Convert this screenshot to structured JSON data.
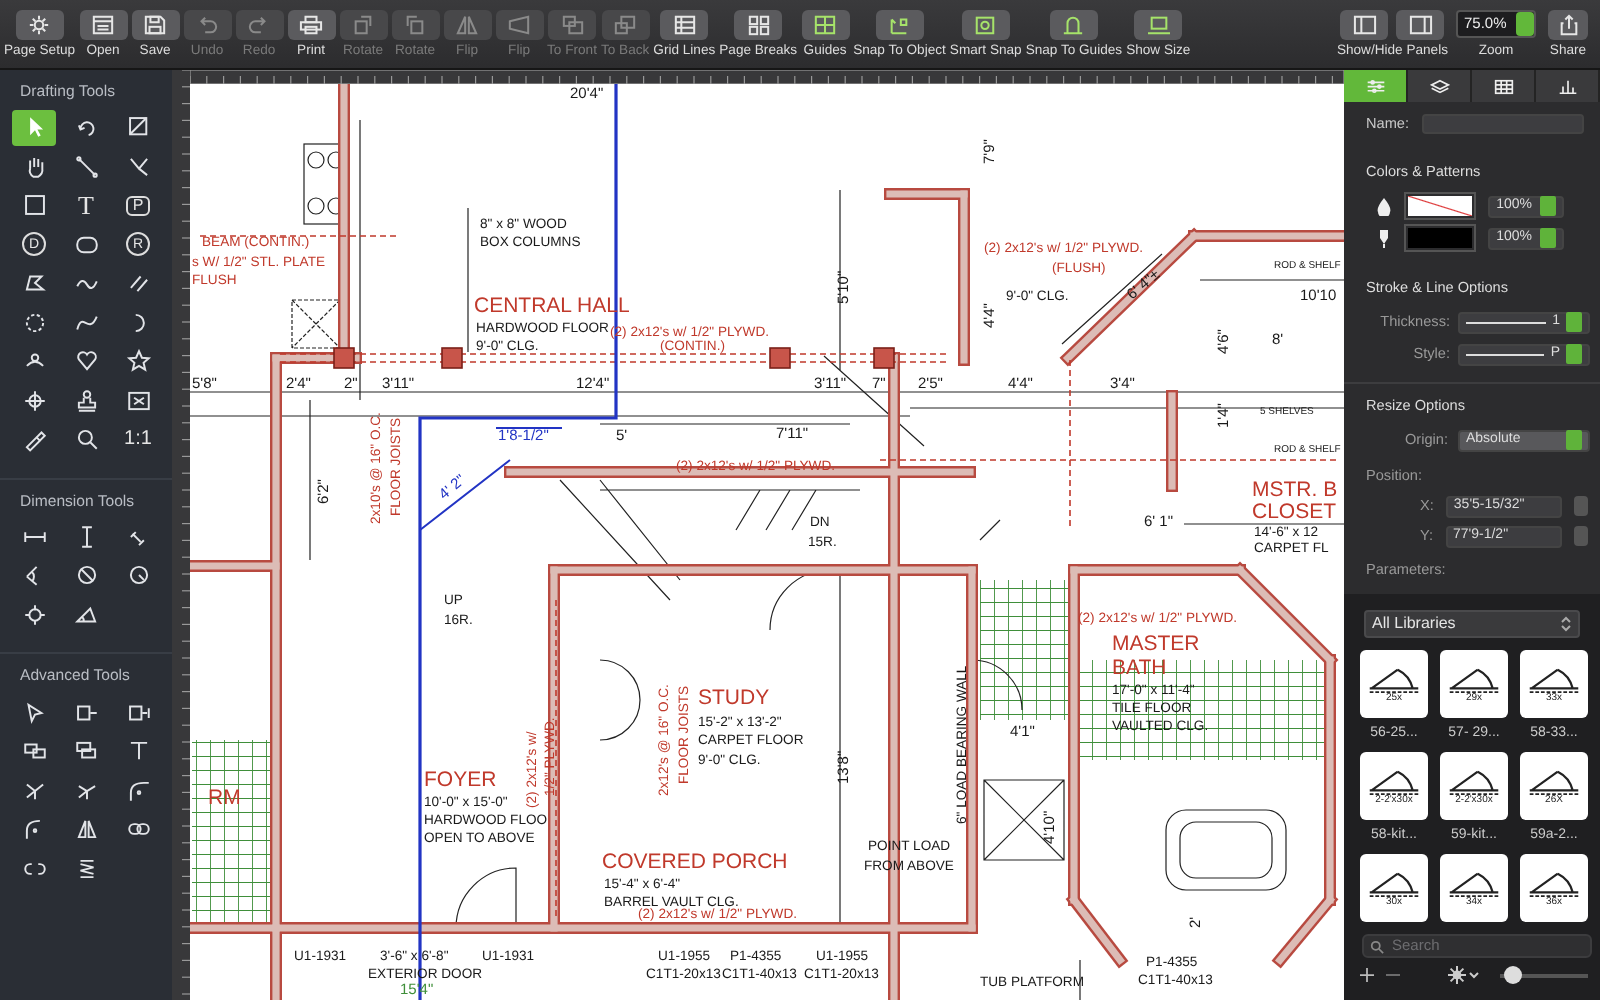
{
  "toolbar": {
    "buttons": [
      {
        "label": "Page Setup",
        "disabled": false,
        "on": false
      },
      {
        "label": "Open",
        "disabled": false,
        "on": false
      },
      {
        "label": "Save",
        "disabled": false,
        "on": false
      },
      {
        "label": "Undo",
        "disabled": true,
        "on": false
      },
      {
        "label": "Redo",
        "disabled": true,
        "on": false
      },
      {
        "label": "Print",
        "disabled": false,
        "on": false
      },
      {
        "label": "Rotate",
        "disabled": true,
        "on": false
      },
      {
        "label": "Rotate",
        "disabled": true,
        "on": false
      },
      {
        "label": "Flip",
        "disabled": true,
        "on": false
      },
      {
        "label": "Flip",
        "disabled": true,
        "on": false
      },
      {
        "label": "To Front",
        "disabled": true,
        "on": false
      },
      {
        "label": "To Back",
        "disabled": true,
        "on": false
      },
      {
        "label": "Grid Lines",
        "disabled": false,
        "on": false
      },
      {
        "label": "Page Breaks",
        "disabled": false,
        "on": false
      },
      {
        "label": "Guides",
        "disabled": false,
        "on": true
      },
      {
        "label": "Snap To Object",
        "disabled": false,
        "on": true
      },
      {
        "label": "Smart Snap",
        "disabled": false,
        "on": true
      },
      {
        "label": "Snap To Guides",
        "disabled": false,
        "on": true
      },
      {
        "label": "Show Size",
        "disabled": false,
        "on": true
      }
    ],
    "panels": {
      "label": "Show/Hide Panels"
    },
    "zoom": {
      "value": "75.0%",
      "label": "Zoom"
    },
    "share": {
      "label": "Share"
    }
  },
  "tool_sections": [
    {
      "title": "Drafting Tools",
      "tools": [
        {
          "selected": true
        },
        {
          "selected": false
        },
        {
          "selected": false
        },
        {
          "selected": false
        },
        {
          "selected": false
        },
        {
          "selected": false
        },
        {
          "selected": false
        },
        {
          "selected": false,
          "glyph": "T"
        },
        {
          "selected": false,
          "glyph": "P"
        },
        {
          "selected": false,
          "glyph": "D"
        },
        {
          "selected": false
        },
        {
          "selected": false,
          "glyph": "R"
        },
        {
          "selected": false
        },
        {
          "selected": false
        },
        {
          "selected": false
        },
        {
          "selected": false
        },
        {
          "selected": false
        },
        {
          "selected": false
        },
        {
          "selected": false
        },
        {
          "selected": false
        },
        {
          "selected": false
        },
        {
          "selected": false
        },
        {
          "selected": false
        },
        {
          "selected": false
        },
        {
          "selected": false
        },
        {
          "selected": false
        },
        {
          "selected": false,
          "glyph": "1:1"
        }
      ]
    },
    {
      "title": "Dimension Tools",
      "tools": [
        {
          "selected": false
        },
        {
          "selected": false
        },
        {
          "selected": false
        },
        {
          "selected": false
        },
        {
          "selected": false
        },
        {
          "selected": false
        },
        {
          "selected": false
        },
        {
          "selected": false
        }
      ]
    },
    {
      "title": "Advanced Tools",
      "tools": [
        {
          "selected": false
        },
        {
          "selected": false
        },
        {
          "selected": false
        },
        {
          "selected": false
        },
        {
          "selected": false
        },
        {
          "selected": false
        },
        {
          "selected": false
        },
        {
          "selected": false
        },
        {
          "selected": false
        },
        {
          "selected": false
        },
        {
          "selected": false
        },
        {
          "selected": false
        },
        {
          "selected": false
        },
        {
          "selected": false
        }
      ]
    }
  ],
  "plan": {
    "labels": [
      {
        "kind": "dim",
        "text": "20'4\""
      },
      {
        "kind": "note",
        "text": "8\" x 8\" WOOD"
      },
      {
        "kind": "beam",
        "text": "BEAM (CONTIN.)"
      },
      {
        "kind": "note",
        "text": "BOX COLUMNS"
      },
      {
        "kind": "beam",
        "text": "s W/ 1/2\" STL. PLATE"
      },
      {
        "kind": "beam",
        "text": "FLUSH"
      },
      {
        "kind": "room",
        "text": "CENTRAL HALL"
      },
      {
        "kind": "note",
        "text": "HARDWOOD FLOOR"
      },
      {
        "kind": "note",
        "text": "9'-0\" CLG."
      },
      {
        "kind": "beam",
        "text": "(2) 2x12's w/ 1/2\" PLYWD."
      },
      {
        "kind": "beam",
        "text": "(CONTIN.)"
      },
      {
        "kind": "dim",
        "text": "5'8\""
      },
      {
        "kind": "dim",
        "text": "2'4\""
      },
      {
        "kind": "dim",
        "text": "2\""
      },
      {
        "kind": "dim",
        "text": "3'11\""
      },
      {
        "kind": "dim",
        "text": "12'4\""
      },
      {
        "kind": "selected",
        "text": "1'8-1/2\""
      },
      {
        "kind": "dim",
        "text": "5'"
      },
      {
        "kind": "selected",
        "text": "4' 2\""
      },
      {
        "kind": "beam",
        "text": "(2) 2x12's w/ 1/2\" PLYWD."
      },
      {
        "kind": "beam",
        "text": "2x10's @ 16\" O.C."
      },
      {
        "kind": "beam",
        "text": "FLOOR JOISTS"
      },
      {
        "kind": "dim",
        "text": "6'2\""
      },
      {
        "kind": "beam",
        "text": "(2) 2x12's w/ 1/2\" PLYWD."
      },
      {
        "kind": "beam",
        "text": "(FLUSH)"
      },
      {
        "kind": "note",
        "text": "9'-0\" CLG."
      },
      {
        "kind": "dim",
        "text": "7'9\""
      },
      {
        "kind": "dim",
        "text": "5'10\""
      },
      {
        "kind": "dim",
        "text": "4'4\""
      },
      {
        "kind": "dim",
        "text": "3'11\""
      },
      {
        "kind": "dim",
        "text": "7\""
      },
      {
        "kind": "dim",
        "text": "2'5\""
      },
      {
        "kind": "dim",
        "text": "4'4\""
      },
      {
        "kind": "dim",
        "text": "3'4\""
      },
      {
        "kind": "dim",
        "text": "7'11\""
      },
      {
        "kind": "dim",
        "text": "6' 4\"±"
      },
      {
        "kind": "note",
        "text": "DN"
      },
      {
        "kind": "note",
        "text": "15R."
      },
      {
        "kind": "small",
        "text": "ROD & SHELF"
      },
      {
        "kind": "dim",
        "text": "10'10"
      },
      {
        "kind": "dim",
        "text": "8'"
      },
      {
        "kind": "dim",
        "text": "4'6\""
      },
      {
        "kind": "small",
        "text": "5 SHELVES"
      },
      {
        "kind": "dim",
        "text": "1'4\""
      },
      {
        "kind": "small",
        "text": "ROD & SHELF"
      },
      {
        "kind": "dim",
        "text": "6' 1\""
      },
      {
        "kind": "room",
        "text": "MSTR. B"
      },
      {
        "kind": "room",
        "text": "CLOSET"
      },
      {
        "kind": "note",
        "text": "14'-6\" x 12"
      },
      {
        "kind": "note",
        "text": "CARPET FL"
      },
      {
        "kind": "note",
        "text": "UP"
      },
      {
        "kind": "note",
        "text": "16R."
      },
      {
        "kind": "room",
        "text": "STUDY"
      },
      {
        "kind": "note",
        "text": "15'-2\" x 13'-2\""
      },
      {
        "kind": "note",
        "text": "CARPET FLOOR"
      },
      {
        "kind": "note",
        "text": "9'-0\" CLG."
      },
      {
        "kind": "beam",
        "text": "2x12's @ 16\" O.C."
      },
      {
        "kind": "beam",
        "text": "FLOOR JOISTS"
      },
      {
        "kind": "beam",
        "text": "(2) 2x12's w/"
      },
      {
        "kind": "beam",
        "text": "1/2\" PLYWD."
      },
      {
        "kind": "room",
        "text": "FOYER"
      },
      {
        "kind": "note",
        "text": "10'-0\" x 15'-0\""
      },
      {
        "kind": "note",
        "text": "HARDWOOD FLOO"
      },
      {
        "kind": "note",
        "text": "OPEN TO ABOVE"
      },
      {
        "kind": "room",
        "text": "COVERED PORCH"
      },
      {
        "kind": "note",
        "text": "15'-4\" x 6'-4\""
      },
      {
        "kind": "note",
        "text": "BARREL VAULT CLG."
      },
      {
        "kind": "beam",
        "text": "(2) 2x12's w/ 1/2\" PLYWD."
      },
      {
        "kind": "note",
        "text": "POINT LOAD"
      },
      {
        "kind": "note",
        "text": "FROM ABOVE"
      },
      {
        "kind": "note",
        "text": "6\" LOAD BEARING WALL"
      },
      {
        "kind": "dim",
        "text": "13'8\""
      },
      {
        "kind": "beam",
        "text": "(2) 2x12's w/ 1/2\" PLYWD."
      },
      {
        "kind": "room",
        "text": "MASTER"
      },
      {
        "kind": "room",
        "text": "BATH"
      },
      {
        "kind": "note",
        "text": "17'-0\" x 11'-4\""
      },
      {
        "kind": "note",
        "text": "TILE FLOOR"
      },
      {
        "kind": "note",
        "text": "VAULTED CLG."
      },
      {
        "kind": "dim",
        "text": "4'1\""
      },
      {
        "kind": "dim",
        "text": "4'10\""
      },
      {
        "kind": "note",
        "text": "U1-1931"
      },
      {
        "kind": "note",
        "text": "3'-6\" x 6'-8\""
      },
      {
        "kind": "note",
        "text": "U1-1931"
      },
      {
        "kind": "note",
        "text": "EXTERIOR DOOR"
      },
      {
        "kind": "grid",
        "text": "15'4\""
      },
      {
        "kind": "note",
        "text": "U1-1955"
      },
      {
        "kind": "note",
        "text": "P1-4355"
      },
      {
        "kind": "note",
        "text": "U1-1955"
      },
      {
        "kind": "note",
        "text": "C1T1-20x13"
      },
      {
        "kind": "note",
        "text": "C1T1-40x13"
      },
      {
        "kind": "note",
        "text": "C1T1-20x13"
      },
      {
        "kind": "dim",
        "text": "2'"
      },
      {
        "kind": "note",
        "text": "TUB PLATFORM"
      },
      {
        "kind": "note",
        "text": "P1-4355"
      },
      {
        "kind": "note",
        "text": "C1T1-40x13"
      },
      {
        "kind": "room",
        "text": "RM"
      }
    ]
  },
  "inspector": {
    "tabs": [
      {
        "selected": true
      },
      {
        "selected": false
      },
      {
        "selected": false
      },
      {
        "selected": false
      }
    ],
    "name": {
      "label": "Name:"
    },
    "colors": {
      "title": "Colors & Patterns",
      "fill_opacity": "100%",
      "stroke_opacity": "100%"
    },
    "stroke_options": {
      "title": "Stroke & Line Options",
      "thickness": {
        "label": "Thickness:",
        "value": "1"
      },
      "style": {
        "label": "Style:",
        "value": "P"
      }
    },
    "resize": {
      "title": "Resize Options",
      "origin": {
        "label": "Origin:",
        "value": "Absolute"
      },
      "position_label": "Position:",
      "x": {
        "label": "X:",
        "value": "35'5-15/32\""
      },
      "y": {
        "label": "Y:",
        "value": "77'9-1/2\""
      },
      "parameters_label": "Parameters:"
    }
  },
  "library": {
    "selector": "All Libraries",
    "items": [
      {
        "tag": "25x",
        "caption": "56-25..."
      },
      {
        "tag": "29x",
        "caption": "57- 29..."
      },
      {
        "tag": "33x",
        "caption": "58-33..."
      },
      {
        "tag": "2-2'x30x",
        "caption": "58-kit..."
      },
      {
        "tag": "2-2'x30x",
        "caption": "59-kit..."
      },
      {
        "tag": "26X",
        "caption": "59a-2..."
      },
      {
        "tag": "30x"
      },
      {
        "tag": "34x"
      },
      {
        "tag": "36x"
      }
    ],
    "search_placeholder": "Search",
    "size": {
      "level": 0.05
    }
  }
}
